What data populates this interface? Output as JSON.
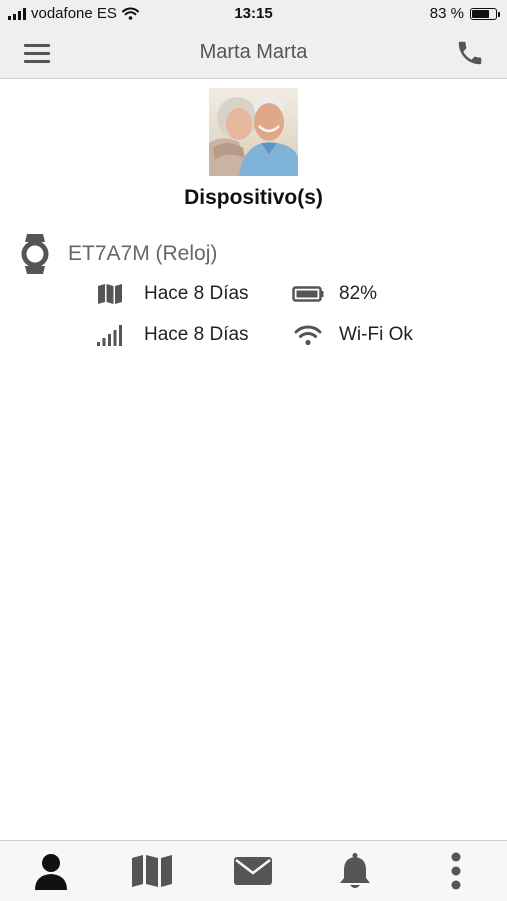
{
  "status_bar": {
    "carrier": "vodafone ES",
    "time": "13:15",
    "battery_text": "83 %",
    "battery_level": 0.83
  },
  "header": {
    "title": "Marta Marta",
    "menu_icon": "hamburger-menu-icon",
    "call_icon": "phone-icon"
  },
  "section": {
    "title": "Dispositivo(s)"
  },
  "device": {
    "name": "ET7A7M (Reloj)",
    "icon": "watch-icon",
    "location_updated": "Hace 8 Días",
    "battery": "82%",
    "signal_updated": "Hace 8 Días",
    "wifi": "Wi-Fi Ok"
  },
  "tabs": [
    {
      "icon": "person-icon",
      "active": true
    },
    {
      "icon": "map-icon",
      "active": false
    },
    {
      "icon": "envelope-icon",
      "active": false
    },
    {
      "icon": "bell-icon",
      "active": false
    },
    {
      "icon": "more-vertical-icon",
      "active": false
    }
  ],
  "colors": {
    "bar_bg": "#efefef",
    "icon_gray": "#555555",
    "tab_active": "#111111",
    "tab_inactive": "#555555"
  }
}
